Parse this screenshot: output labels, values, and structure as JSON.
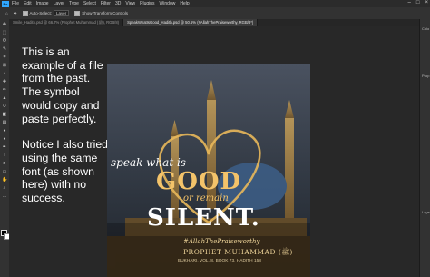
{
  "menubar": {
    "app_logo": "Ps",
    "items": [
      "File",
      "Edit",
      "Image",
      "Layer",
      "Type",
      "Select",
      "Filter",
      "3D",
      "View",
      "Plugins",
      "Window",
      "Help"
    ],
    "window_controls": [
      "minimize-icon",
      "maximize-icon",
      "close-icon"
    ]
  },
  "optionsbar": {
    "auto_select_label": "Auto-Select:",
    "auto_select_value": "Layer",
    "transform_label": "Show Transform Controls"
  },
  "tabs": [
    {
      "label": "Smile_Hadith.psd @ 66.7% (Prophet Muhammad (ﷺ), RGB/8)",
      "active": false
    },
    {
      "label": "SpeakWhatIsGood_Hadith.psd @ 50.5% (#AllahThePraiseworthy, RGB/8*)",
      "active": true
    }
  ],
  "note": {
    "para1": "This is an example of a file from the past. The symbol would copy and paste perfectly.",
    "para2": "Notice I also tried using the same font (as shown here) with no success."
  },
  "artwork": {
    "line1": "speak what is",
    "line2": "GOOD",
    "line3": "or remain",
    "line4": "SILENT.",
    "hashtag": "#AllahThePraiseworthy",
    "prophet": "PROPHET MUHAMMAD (ﷺ)",
    "source": "BUKHARI, VOL. 8, BOOK 73, HADITH 158"
  },
  "rightdock": {
    "label_top": "Colo",
    "label_mid": "Prop",
    "label_low": "Laye"
  },
  "colors": {
    "accent_blue": "#31a8ff",
    "gold": "#e9b85a",
    "app_bg": "#282828"
  }
}
